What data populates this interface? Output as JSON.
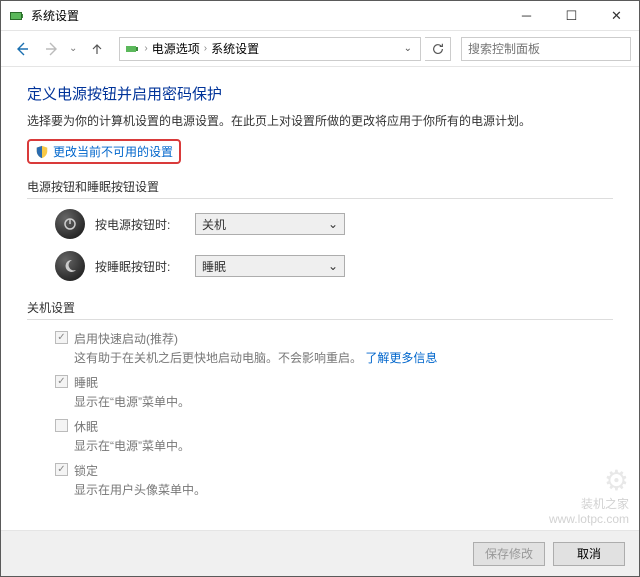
{
  "window": {
    "title": "系统设置"
  },
  "nav": {
    "breadcrumb": [
      "电源选项",
      "系统设置"
    ],
    "search_placeholder": "搜索控制面板"
  },
  "page": {
    "heading": "定义电源按钮并启用密码保护",
    "description": "选择要为你的计算机设置的电源设置。在此页上对设置所做的更改将应用于你所有的电源计划。",
    "change_link": "更改当前不可用的设置"
  },
  "buttons_section": {
    "title": "电源按钮和睡眠按钮设置",
    "rows": [
      {
        "label": "按电源按钮时:",
        "value": "关机"
      },
      {
        "label": "按睡眠按钮时:",
        "value": "睡眠"
      }
    ]
  },
  "shutdown_section": {
    "title": "关机设置",
    "items": [
      {
        "label": "启用快速启动(推荐)",
        "sub": "这有助于在关机之后更快地启动电脑。不会影响重启。",
        "link": "了解更多信息",
        "checked": true
      },
      {
        "label": "睡眠",
        "sub": "显示在“电源”菜单中。",
        "checked": true
      },
      {
        "label": "休眠",
        "sub": "显示在“电源”菜单中。",
        "checked": false
      },
      {
        "label": "锁定",
        "sub": "显示在用户头像菜单中。",
        "checked": true
      }
    ]
  },
  "footer": {
    "save": "保存修改",
    "cancel": "取消"
  },
  "watermark": {
    "name": "装机之家",
    "url": "www.lotpc.com"
  }
}
